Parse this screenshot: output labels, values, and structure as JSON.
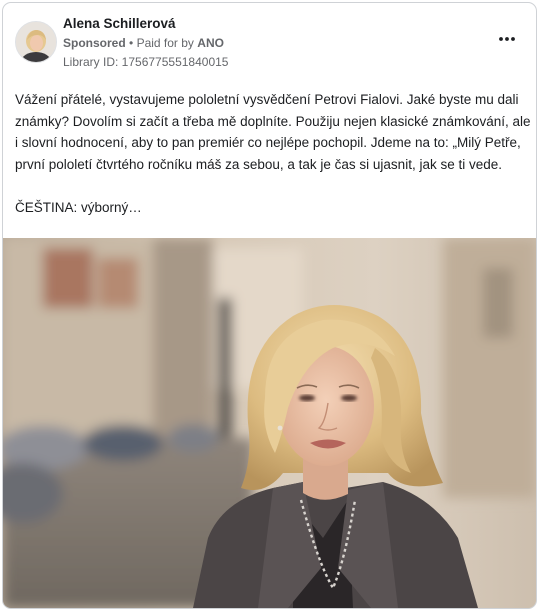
{
  "ad": {
    "author": "Alena Schillerová",
    "sponsored_label": "Sponsored",
    "separator": "•",
    "paid_for_by_label": "Paid for by",
    "payer": "ANO",
    "library_id": "Library ID: 1756775551840015",
    "more_icon": "more-horizontal-icon"
  },
  "post": {
    "paragraph_1": "Vážení přátelé, vystavujeme pololetní vysvědčení Petrovi Fialovi. Jaké byste mu dali známky? Dovolím si začít a třeba mě doplníte. Použiju nejen klasické známkování, ale i slovní hodnocení, aby to pan premiér co nejlépe pochopil. Jdeme na to: „Milý Petře, první pololetí čtvrtého ročníku máš za sebou, a tak je čas si ujasnit, jak se ti vede.",
    "paragraph_2": "ČEŠTINA: výborný…"
  },
  "colors": {
    "text_primary": "#1c1e21",
    "text_secondary": "#65676b",
    "card_border": "#cfd2d6"
  }
}
